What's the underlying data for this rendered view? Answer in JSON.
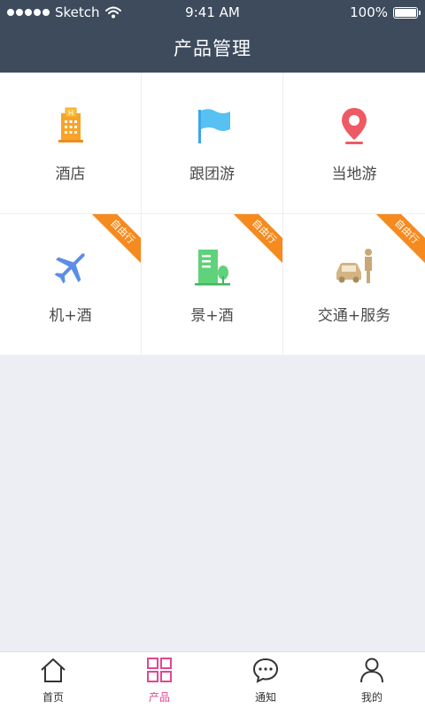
{
  "status_bar": {
    "carrier": "Sketch",
    "time": "9:41 AM",
    "battery": "100%"
  },
  "header": {
    "title": "产品管理"
  },
  "products": [
    {
      "label": "酒店",
      "icon": "hotel-icon",
      "badge": ""
    },
    {
      "label": "跟团游",
      "icon": "flag-icon",
      "badge": ""
    },
    {
      "label": "当地游",
      "icon": "location-pin-icon",
      "badge": ""
    },
    {
      "label": "机+酒",
      "icon": "airplane-icon",
      "badge": "自由行"
    },
    {
      "label": "景+酒",
      "icon": "building-tree-icon",
      "badge": "自由行"
    },
    {
      "label": "交通+服务",
      "icon": "car-person-icon",
      "badge": "自由行"
    }
  ],
  "tabbar": {
    "items": [
      {
        "label": "首页",
        "icon": "home-icon",
        "active": false
      },
      {
        "label": "产品",
        "icon": "grid-icon",
        "active": true
      },
      {
        "label": "通知",
        "icon": "chat-icon",
        "active": false
      },
      {
        "label": "我的",
        "icon": "user-icon",
        "active": false
      }
    ]
  },
  "colors": {
    "header_bg": "#3d4b5d",
    "badge": "#f58a1f",
    "active_tab": "#e04891",
    "page_bg": "#eceef3"
  }
}
